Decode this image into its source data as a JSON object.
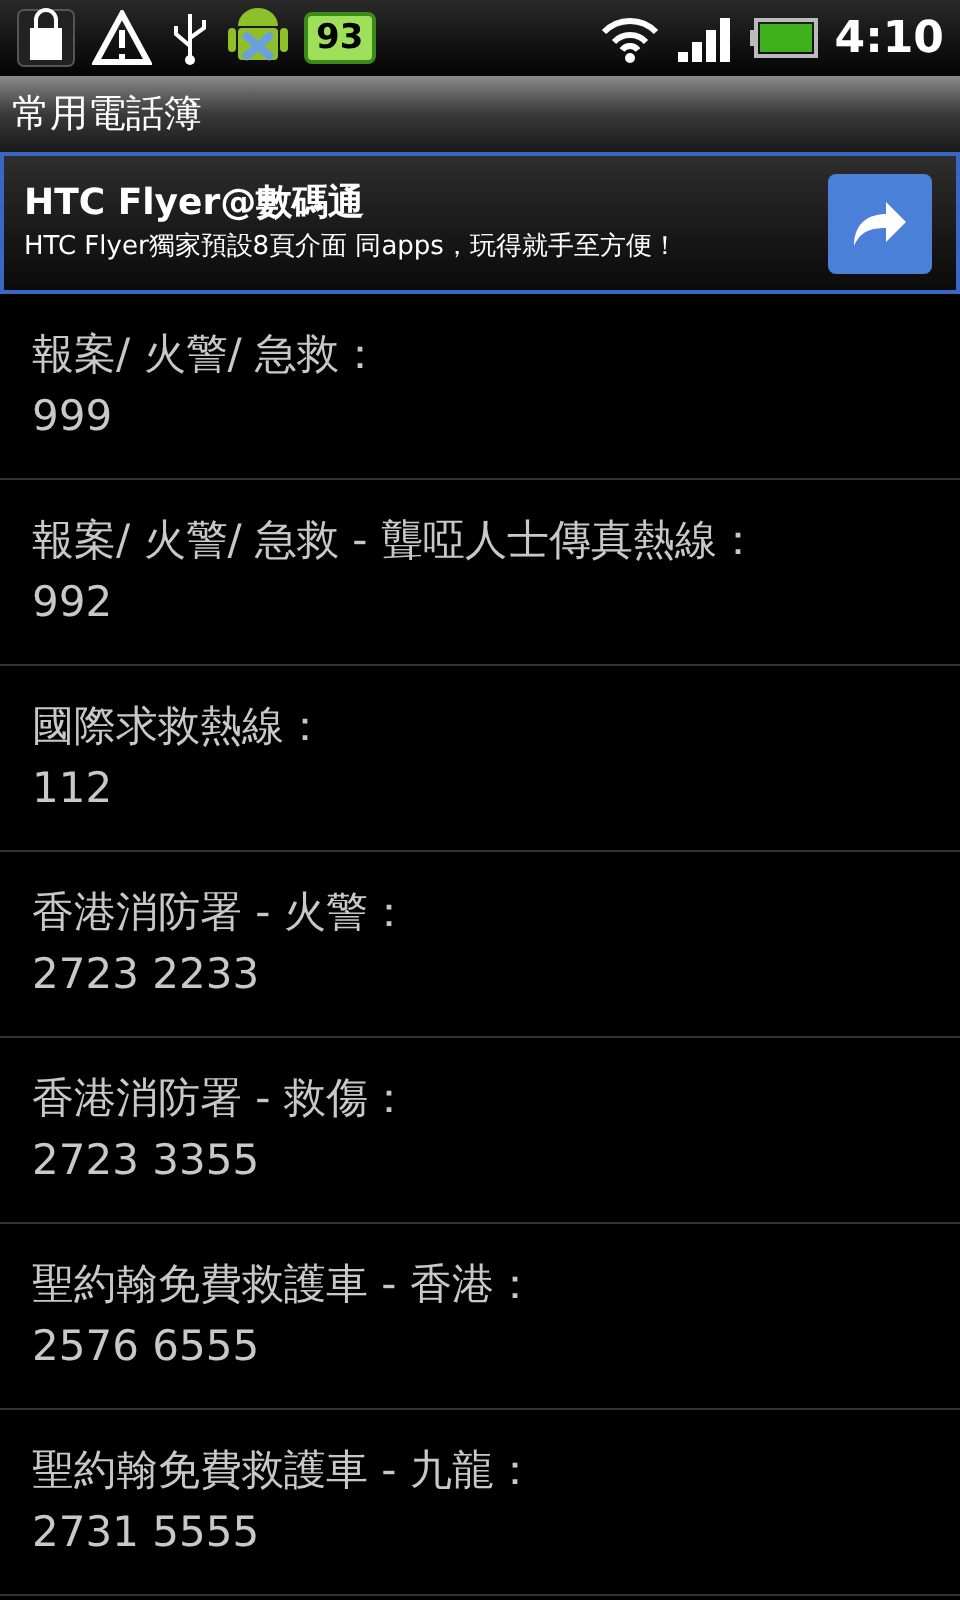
{
  "status_bar": {
    "battery_badge": "93",
    "time": "4:10"
  },
  "title_bar": {
    "title": "常用電話簿"
  },
  "ad_banner": {
    "headline": "HTC Flyer@數碼通",
    "text": "HTC Flyer獨家預設8頁介面 同apps，玩得就手至方便！"
  },
  "contacts": [
    {
      "name": "報案/ 火警/ 急救：",
      "number": "999"
    },
    {
      "name": "報案/ 火警/ 急救 - 聾啞人士傳真熱線：",
      "number": "992"
    },
    {
      "name": "國際求救熱線：",
      "number": "112"
    },
    {
      "name": "香港消防署 - 火警：",
      "number": "2723 2233"
    },
    {
      "name": "香港消防署 - 救傷：",
      "number": "2723 3355"
    },
    {
      "name": "聖約翰免費救護車 - 香港：",
      "number": "2576 6555"
    },
    {
      "name": "聖約翰免費救護車 - 九龍：",
      "number": "2731 5555"
    }
  ]
}
